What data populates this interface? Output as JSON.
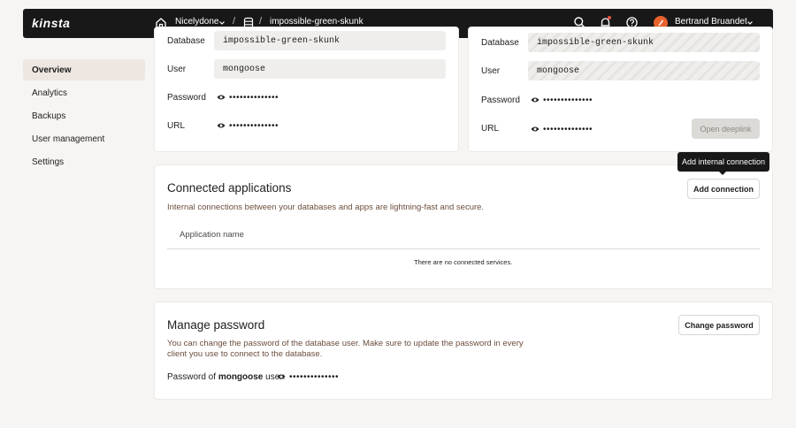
{
  "topbar": {
    "logo": "kinsta",
    "site_name": "Nicelydone",
    "separator": "/",
    "database_name": "impossible-green-skunk",
    "user_name": "Bertrand Bruandet",
    "icons": [
      "home-icon",
      "chevron-down-icon",
      "database-icon",
      "search-icon",
      "bell-icon",
      "help-icon",
      "avatar",
      "chevron-down-icon"
    ]
  },
  "sidebar": {
    "items": [
      {
        "label": "Overview",
        "active": true
      },
      {
        "label": "Analytics"
      },
      {
        "label": "Backups"
      },
      {
        "label": "User management"
      },
      {
        "label": "Settings"
      }
    ]
  },
  "internal_card": {
    "database_label": "Database",
    "database_value": "impossible-green-skunk",
    "user_label": "User",
    "user_value": "mongoose",
    "password_label": "Password",
    "password_mask": "••••••••••••••",
    "url_label": "URL",
    "url_mask": "••••••••••••••"
  },
  "external_card": {
    "database_label": "Database",
    "database_value": "impossible-green-skunk",
    "user_label": "User",
    "user_value": "mongoose",
    "password_label": "Password",
    "password_mask": "••••••••••••••",
    "url_label": "URL",
    "url_mask": "••••••••••••••",
    "open_deeplink_label": "Open deeplink"
  },
  "connected_apps": {
    "title": "Connected applications",
    "description": "Internal connections between your databases and apps are lightning-fast and secure.",
    "tooltip": "Add internal connection",
    "add_button": "Add connection",
    "column_header": "Application name",
    "empty_text": "There are no connected services."
  },
  "manage_password": {
    "title": "Manage password",
    "description_line1": "You can change the password of the database user. Make sure to update the password in every",
    "description_line2": "client you use to connect to the database.",
    "change_button": "Change password",
    "pw_prefix": "Password of ",
    "pw_user": "mongoose",
    "pw_suffix": " user:",
    "pw_mask": "••••••••••••••"
  }
}
